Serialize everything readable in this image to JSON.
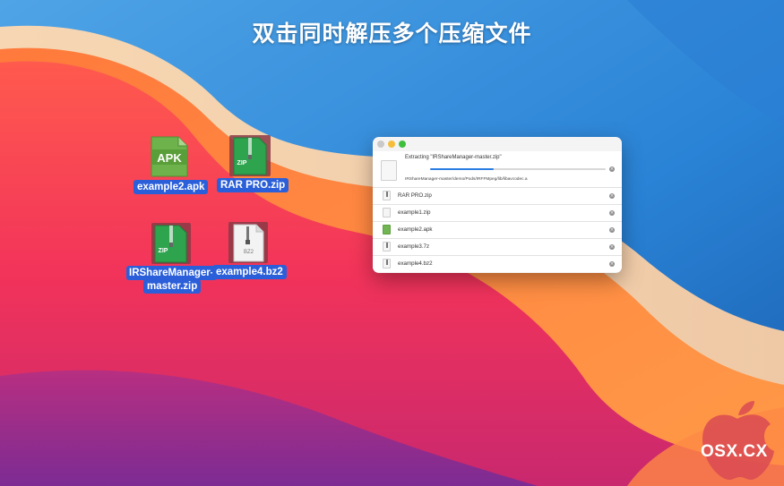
{
  "headline": "双击同时解压多个压缩文件",
  "desktop_files": [
    {
      "label": "example2.apk",
      "type": "apk",
      "icon_text": "APK"
    },
    {
      "label": "RAR PRO.zip",
      "type": "zip",
      "icon_text": "ZIP"
    },
    {
      "label_line1": "IRShareManager-",
      "label_line2": "master.zip",
      "type": "zip",
      "icon_text": "ZIP"
    },
    {
      "label": "example4.bz2",
      "type": "bz2",
      "icon_text": "BZ2"
    }
  ],
  "window": {
    "current": {
      "title": "Extracting \"IRShareManager-master.zip\"",
      "path": "IRShareManager-master/demo/Pods/IRFFMpeg/lib/libavcodec.a",
      "progress": 0.36
    },
    "queue": [
      {
        "name": "RAR PRO.zip",
        "icon": "zip-icon"
      },
      {
        "name": "example1.zip",
        "icon": "doc-icon"
      },
      {
        "name": "example2.apk",
        "icon": "apk-icon"
      },
      {
        "name": "example3.7z",
        "icon": "zip-icon"
      },
      {
        "name": "example4.bz2",
        "icon": "zip-icon"
      }
    ],
    "cancel_glyph": "×"
  },
  "watermark": "OSX.CX",
  "colors": {
    "accent": "#2a7de1",
    "selection": "#2b5fd9",
    "apk_green": "#73b552",
    "zip_green": "#2ea44f"
  }
}
